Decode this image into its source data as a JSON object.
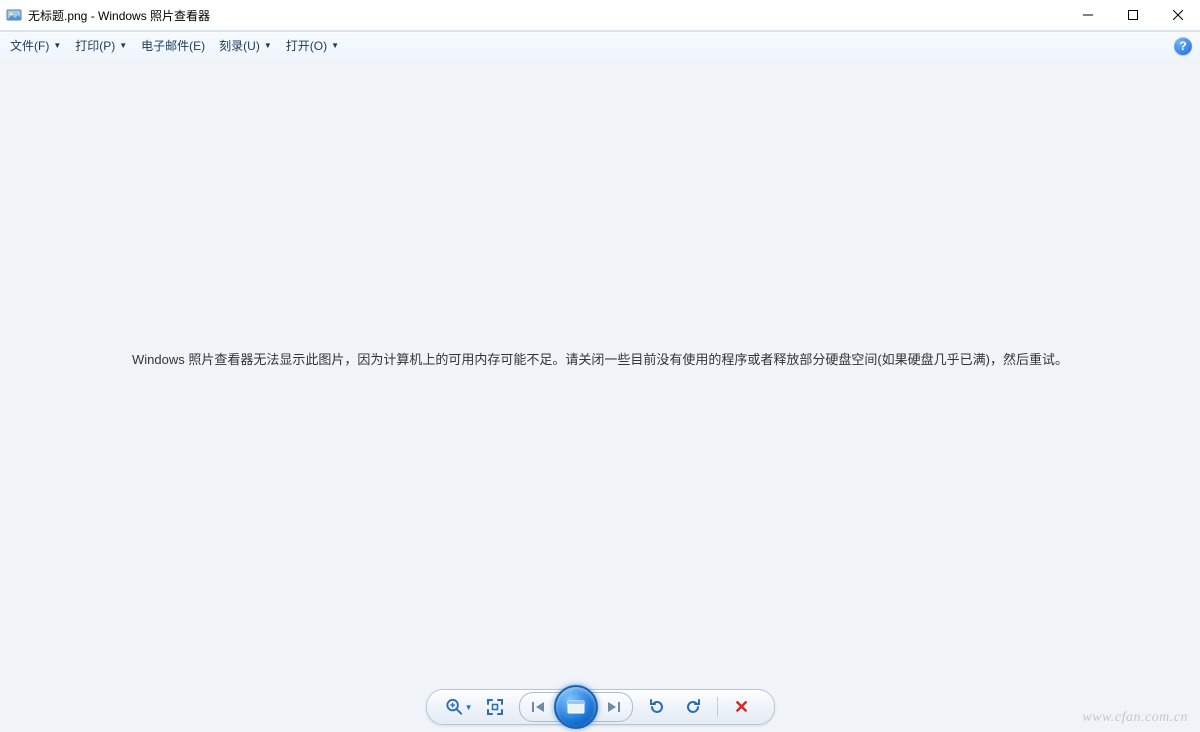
{
  "titlebar": {
    "filename": "无标题.png",
    "separator": " - ",
    "appname": "Windows 照片查看器"
  },
  "menubar": {
    "items": [
      {
        "label": "文件(F)",
        "hasDropdown": true
      },
      {
        "label": "打印(P)",
        "hasDropdown": true
      },
      {
        "label": "电子邮件(E)",
        "hasDropdown": false
      },
      {
        "label": "刻录(U)",
        "hasDropdown": true
      },
      {
        "label": "打开(O)",
        "hasDropdown": true
      }
    ],
    "help_symbol": "?"
  },
  "content": {
    "error_message": "Windows 照片查看器无法显示此图片，因为计算机上的可用内存可能不足。请关闭一些目前没有使用的程序或者释放部分硬盘空间(如果硬盘几乎已满)，然后重试。"
  },
  "toolbar": {
    "zoom_name": "zoom-icon",
    "fit_name": "fit-to-window-icon",
    "prev_name": "previous-icon",
    "slideshow_name": "slideshow-icon",
    "next_name": "next-icon",
    "rotate_ccw_name": "rotate-left-icon",
    "rotate_cw_name": "rotate-right-icon",
    "delete_name": "delete-icon"
  },
  "watermark": "www.cfan.com.cn"
}
